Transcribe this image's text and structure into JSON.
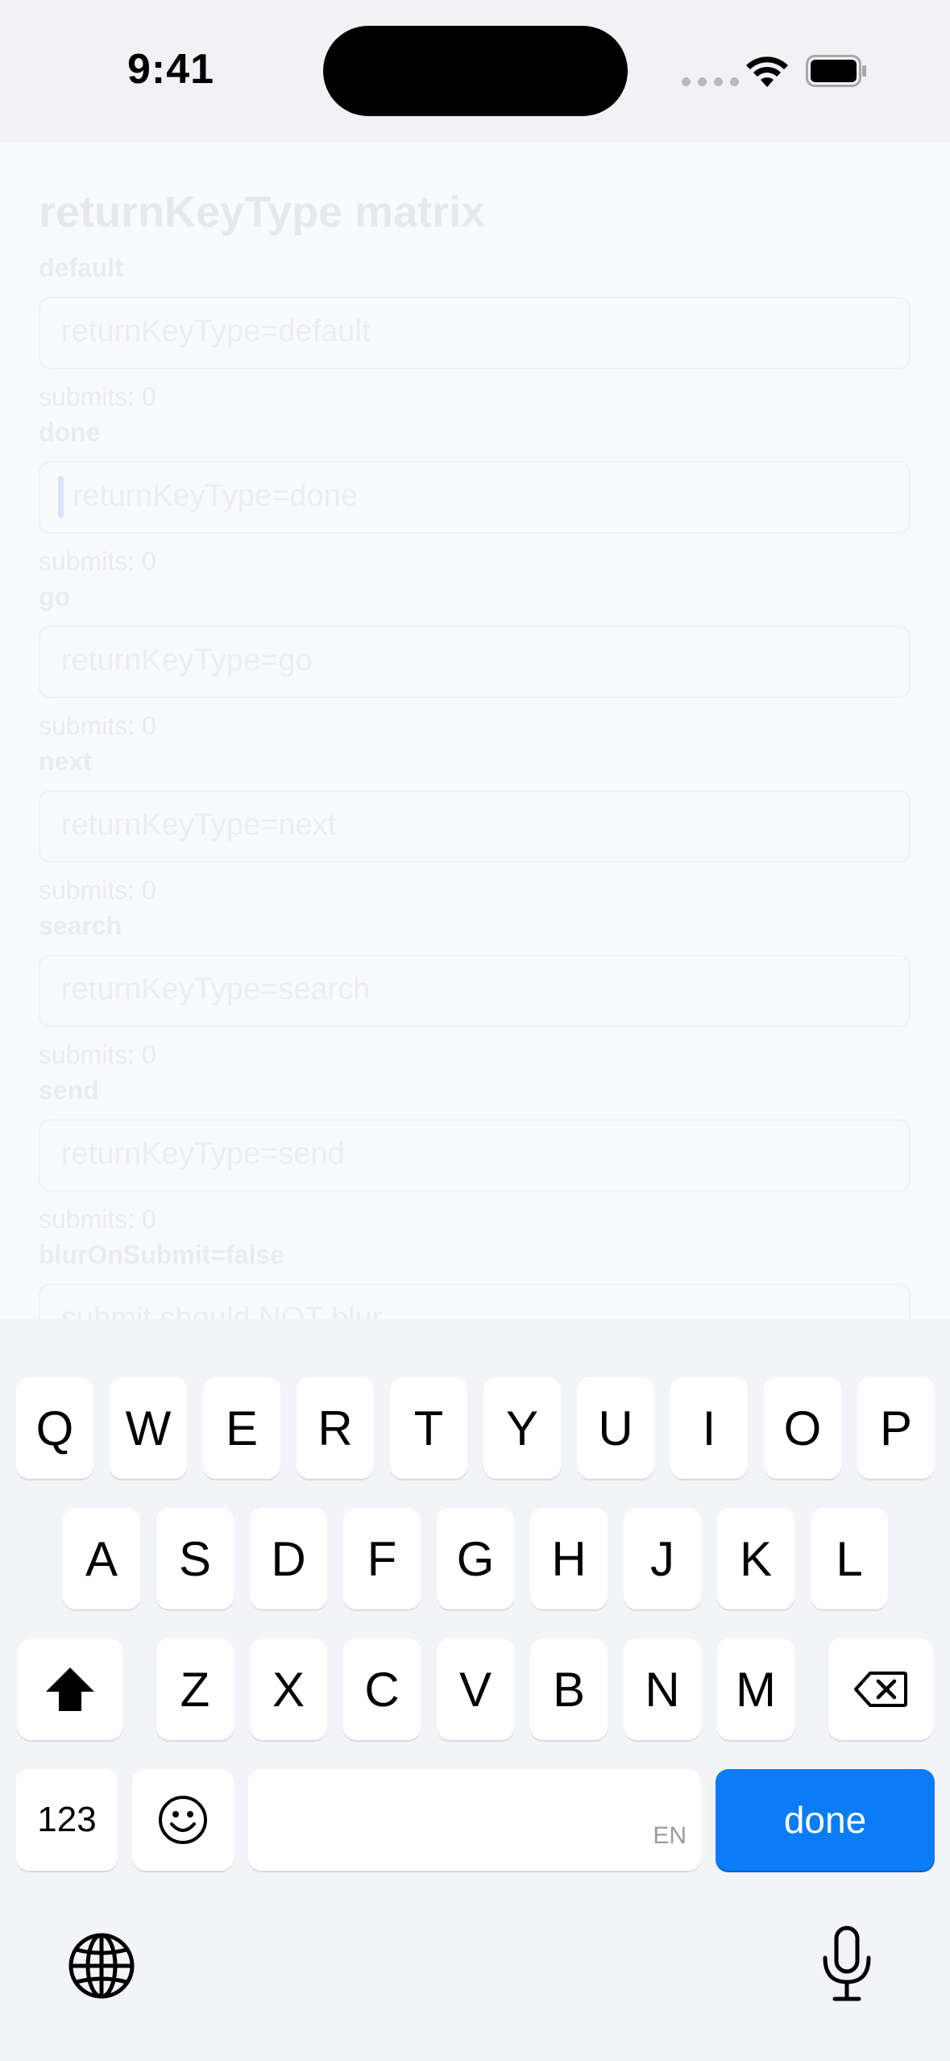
{
  "status_bar": {
    "time": "9:41",
    "icons": [
      "cellular-dots-icon",
      "wifi-icon",
      "battery-icon"
    ]
  },
  "screen": {
    "title": "returnKeyType matrix",
    "sections": [
      {
        "label": "default",
        "placeholder": "returnKeyType=default",
        "counter": "submits: 0"
      },
      {
        "label": "done",
        "placeholder": "returnKeyType=done",
        "counter": "submits: 0",
        "focused": true
      },
      {
        "label": "go",
        "placeholder": "returnKeyType=go",
        "counter": "submits: 0"
      },
      {
        "label": "next",
        "placeholder": "returnKeyType=next",
        "counter": "submits: 0"
      },
      {
        "label": "search",
        "placeholder": "returnKeyType=search",
        "counter": "submits: 0"
      },
      {
        "label": "send",
        "placeholder": "returnKeyType=send",
        "counter": "submits: 0"
      },
      {
        "label": "blurOnSubmit=false",
        "placeholder": "submit should NOT blur",
        "counter": ""
      }
    ]
  },
  "keyboard": {
    "row1": [
      "Q",
      "W",
      "E",
      "R",
      "T",
      "Y",
      "U",
      "I",
      "O",
      "P"
    ],
    "row2": [
      "A",
      "S",
      "D",
      "F",
      "G",
      "H",
      "J",
      "K",
      "L"
    ],
    "row3": [
      "Z",
      "X",
      "C",
      "V",
      "B",
      "N",
      "M"
    ],
    "numbers_label": "123",
    "space_language": "EN",
    "return_label": "done",
    "icons": [
      "shift-icon",
      "delete-icon",
      "emoji-icon",
      "globe-icon",
      "microphone-icon"
    ],
    "colors": {
      "return_key": "#0b7cf8",
      "key": "#ffffff",
      "background": "#f3f4f8"
    }
  }
}
